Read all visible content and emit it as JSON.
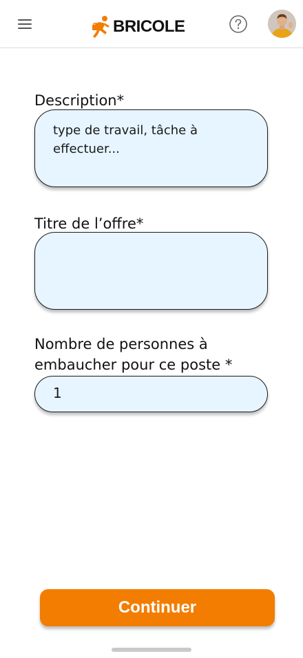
{
  "header": {
    "brand": "BRICOLE",
    "menu_icon": "hamburger-menu-icon",
    "help_icon": "question-circle-icon",
    "accent_color": "#f27d00"
  },
  "form": {
    "description": {
      "label": "Description*",
      "placeholder": "type de travail, tâche à effectuer..."
    },
    "title": {
      "label": "Titre de l’offre*",
      "value": ""
    },
    "headcount": {
      "label": "Nombre de personnes à embaucher pour ce poste *",
      "value": "1"
    }
  },
  "actions": {
    "continue_label": "Continuer"
  }
}
